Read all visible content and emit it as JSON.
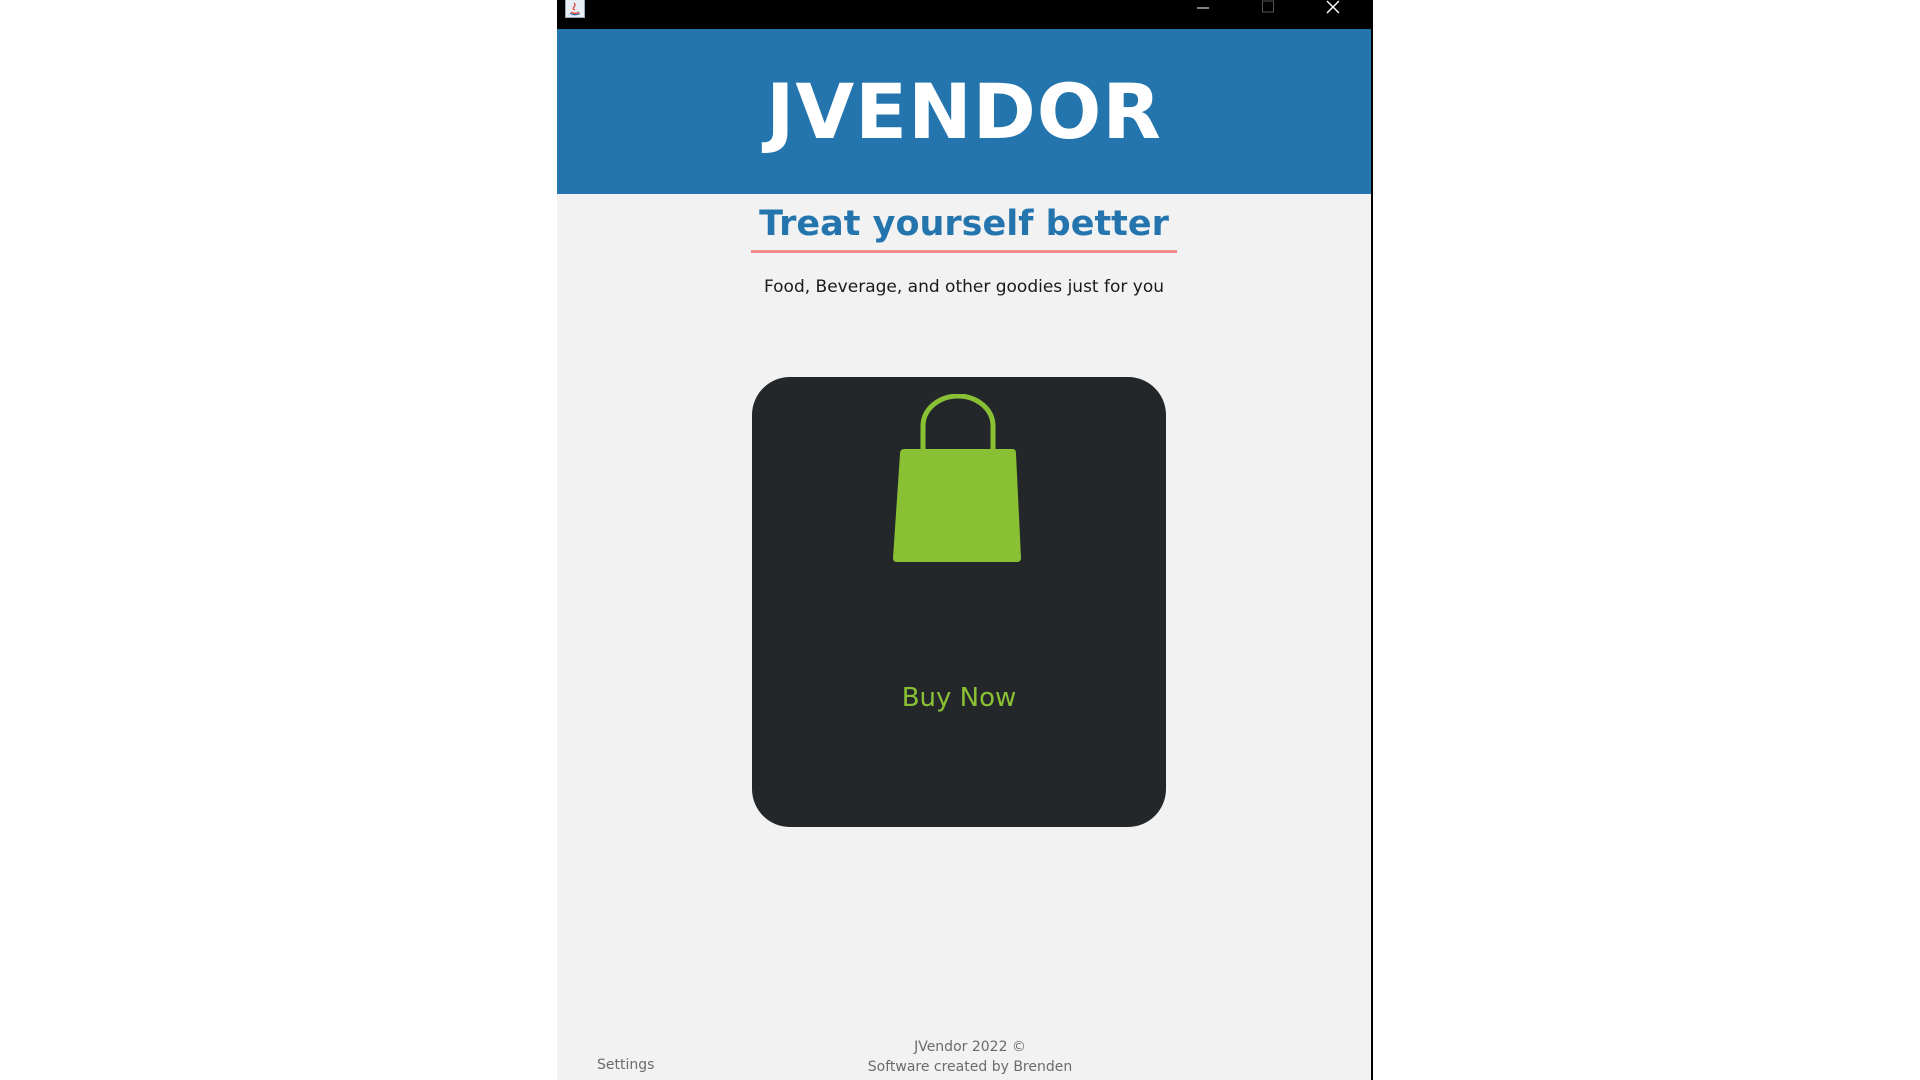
{
  "window": {
    "controls": {
      "minimize_icon": "minimize-icon",
      "maximize_icon": "maximize-icon",
      "close_icon": "close-icon"
    }
  },
  "header": {
    "title": "JVENDOR",
    "background_color": "#2475ae"
  },
  "hero": {
    "tagline": "Treat yourself better",
    "subtitle": "Food, Beverage, and other goodies just for you"
  },
  "buy_card": {
    "icon": "shopping-bag-icon",
    "label": "Buy Now",
    "card_color": "#23272a",
    "accent_color": "#8ac134"
  },
  "footer": {
    "settings_label": "Settings",
    "copyright": "JVendor 2022 ©",
    "credit": "Software created by Brenden"
  }
}
